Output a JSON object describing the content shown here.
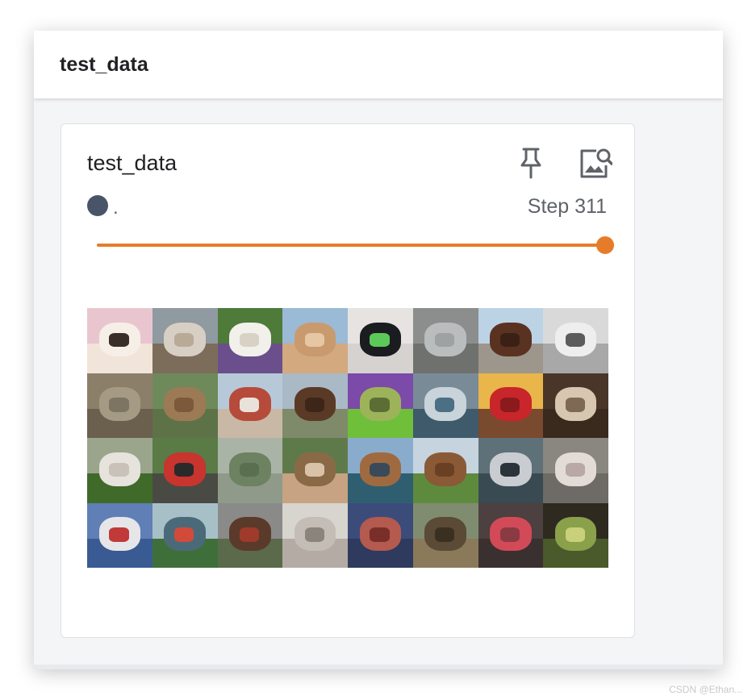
{
  "header": {
    "title": "test_data"
  },
  "card": {
    "title": "test_data",
    "pin_icon": "pin-icon",
    "enlarge_icon": "image-search-icon",
    "run": {
      "label": ".",
      "color": "#4a5469"
    },
    "step_label": "Step 311",
    "slider": {
      "position_fraction": 1.0,
      "color": "#e67c2a"
    }
  },
  "image_grid": {
    "columns": 8,
    "rows": 4,
    "tiles": [
      {
        "subject": "dog",
        "bg": "#e9c6cf",
        "a": "#f1e4d9",
        "b": "#f5efe8",
        "c": "#3a2e28"
      },
      {
        "subject": "horse",
        "bg": "#8f9aa1",
        "a": "#7c6c5a",
        "b": "#d8cfc4",
        "c": "#b9aa98"
      },
      {
        "subject": "dog",
        "bg": "#4e7a3a",
        "a": "#6a4f8c",
        "b": "#f2f0ea",
        "c": "#d8d2c6"
      },
      {
        "subject": "cat",
        "bg": "#9bbad6",
        "a": "#d3a97f",
        "b": "#c99a6e",
        "c": "#e6c7a3"
      },
      {
        "subject": "airplane",
        "bg": "#e6e3e0",
        "a": "#d6d2cf",
        "b": "#1b1c20",
        "c": "#5cc85a"
      },
      {
        "subject": "automobile",
        "bg": "#8b8e8c",
        "a": "#6f716f",
        "b": "#b9bdbe",
        "c": "#9ea2a3"
      },
      {
        "subject": "horse",
        "bg": "#bcd3e6",
        "a": "#9d968c",
        "b": "#5a3221",
        "c": "#3b2016"
      },
      {
        "subject": "automobile",
        "bg": "#d9d9d9",
        "a": "#a8a8a8",
        "b": "#eeeeee",
        "c": "#5c5c5c"
      },
      {
        "subject": "frog",
        "bg": "#8c7f6a",
        "a": "#6b5f4e",
        "b": "#a59a84",
        "c": "#7e7462"
      },
      {
        "subject": "deer",
        "bg": "#6f8a5a",
        "a": "#5e7248",
        "b": "#9c7a55",
        "c": "#7a5a3a"
      },
      {
        "subject": "ship",
        "bg": "#b7c9d8",
        "a": "#c9b8a6",
        "b": "#b64b3b",
        "c": "#e8e2da"
      },
      {
        "subject": "horse",
        "bg": "#aab9c6",
        "a": "#7f8a6a",
        "b": "#5a3a26",
        "c": "#3d2618"
      },
      {
        "subject": "frog",
        "bg": "#7c4aa8",
        "a": "#6fbf3a",
        "b": "#9db35a",
        "c": "#5c6e34"
      },
      {
        "subject": "ship",
        "bg": "#7a8b98",
        "a": "#3f5a6a",
        "b": "#c9d3da",
        "c": "#4b6f84"
      },
      {
        "subject": "automobile",
        "bg": "#e8b64a",
        "a": "#7a4a2e",
        "b": "#c8262a",
        "c": "#8a1a1c"
      },
      {
        "subject": "dog",
        "bg": "#4a3628",
        "a": "#3a2a1e",
        "b": "#d7c6b0",
        "c": "#7e6a54"
      },
      {
        "subject": "dog",
        "bg": "#9aa58c",
        "a": "#3f6a2a",
        "b": "#e6e2dc",
        "c": "#c8c2b8"
      },
      {
        "subject": "truck",
        "bg": "#5a7a46",
        "a": "#4a4a44",
        "b": "#c8342e",
        "c": "#2a2a2a"
      },
      {
        "subject": "frog",
        "bg": "#a9b4a6",
        "a": "#8f9a8a",
        "b": "#6c8260",
        "c": "#5a6e50"
      },
      {
        "subject": "bird",
        "bg": "#5f7a4a",
        "a": "#c7a383",
        "b": "#8a6a46",
        "c": "#d9c3a8"
      },
      {
        "subject": "ship",
        "bg": "#8aaccc",
        "a": "#2f5e70",
        "b": "#a06a40",
        "c": "#3a4a5a"
      },
      {
        "subject": "horse",
        "bg": "#c5d4df",
        "a": "#5e8a3e",
        "b": "#8a5a36",
        "c": "#6a4024"
      },
      {
        "subject": "ship",
        "bg": "#5e7078",
        "a": "#3a4a52",
        "b": "#c9ccd0",
        "c": "#2a343a"
      },
      {
        "subject": "ship",
        "bg": "#8a8680",
        "a": "#6e6a66",
        "b": "#e3dcd6",
        "c": "#b8a9a4"
      },
      {
        "subject": "ship",
        "bg": "#5f7fb6",
        "a": "#3a5a94",
        "b": "#e6e6e8",
        "c": "#c03a3a"
      },
      {
        "subject": "ship",
        "bg": "#a7c0c8",
        "a": "#3e6f3a",
        "b": "#4a6a7a",
        "c": "#d24a3a"
      },
      {
        "subject": "truck",
        "bg": "#8a8a88",
        "a": "#5a6a4a",
        "b": "#5a3a2a",
        "c": "#a03a2a"
      },
      {
        "subject": "airplane",
        "bg": "#d8d4ce",
        "a": "#b4aca4",
        "b": "#c4bdb6",
        "c": "#8a847c"
      },
      {
        "subject": "ship",
        "bg": "#3b4c7a",
        "a": "#2e3a5e",
        "b": "#b45a4e",
        "c": "#7a2e2a"
      },
      {
        "subject": "deer",
        "bg": "#7f8c70",
        "a": "#8a7a5a",
        "b": "#5a4a36",
        "c": "#3a3022"
      },
      {
        "subject": "dog",
        "bg": "#4c4040",
        "a": "#3a3030",
        "b": "#d24a58",
        "c": "#8a3a42"
      },
      {
        "subject": "frog",
        "bg": "#2e2a20",
        "a": "#4a5a2a",
        "b": "#8aa04a",
        "c": "#c8d07a"
      }
    ]
  },
  "watermark": "CSDN @Ethan..."
}
